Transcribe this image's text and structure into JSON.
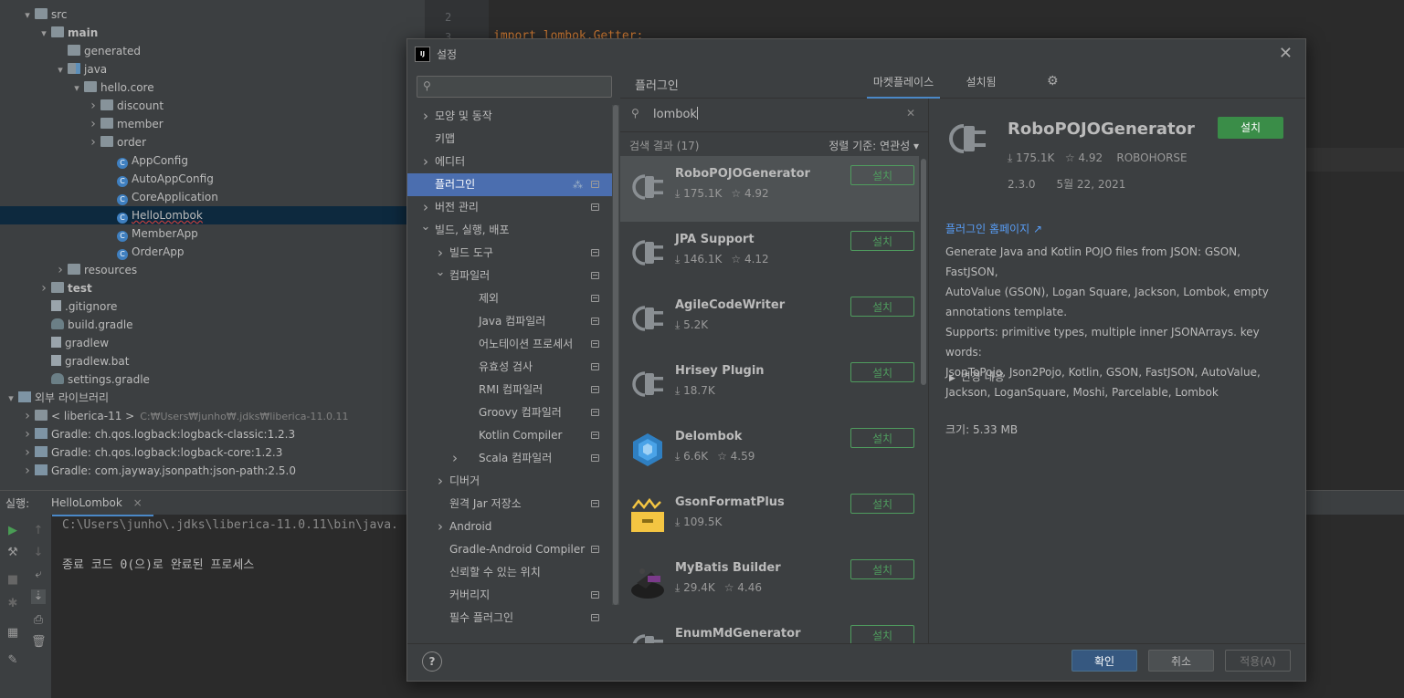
{
  "project_tree": [
    {
      "label": "src",
      "indent": 1,
      "arrow": "v",
      "icon": "folder",
      "bold": false
    },
    {
      "label": "main",
      "indent": 2,
      "arrow": "v",
      "icon": "folder",
      "bold": true
    },
    {
      "label": "generated",
      "indent": 3,
      "arrow": "",
      "icon": "folder",
      "bold": false
    },
    {
      "label": "java",
      "indent": 3,
      "arrow": "v",
      "icon": "folder-src",
      "bold": false
    },
    {
      "label": "hello.core",
      "indent": 4,
      "arrow": "v",
      "icon": "folder",
      "bold": false
    },
    {
      "label": "discount",
      "indent": 5,
      "arrow": ">",
      "icon": "folder",
      "bold": false
    },
    {
      "label": "member",
      "indent": 5,
      "arrow": ">",
      "icon": "folder",
      "bold": false
    },
    {
      "label": "order",
      "indent": 5,
      "arrow": ">",
      "icon": "folder",
      "bold": false
    },
    {
      "label": "AppConfig",
      "indent": 6,
      "arrow": "",
      "icon": "class",
      "bold": false
    },
    {
      "label": "AutoAppConfig",
      "indent": 6,
      "arrow": "",
      "icon": "class",
      "bold": false
    },
    {
      "label": "CoreApplication",
      "indent": 6,
      "arrow": "",
      "icon": "class",
      "bold": false
    },
    {
      "label": "HelloLombok",
      "indent": 6,
      "arrow": "",
      "icon": "class",
      "bold": false,
      "selected": true
    },
    {
      "label": "MemberApp",
      "indent": 6,
      "arrow": "",
      "icon": "class",
      "bold": false
    },
    {
      "label": "OrderApp",
      "indent": 6,
      "arrow": "",
      "icon": "class",
      "bold": false
    },
    {
      "label": "resources",
      "indent": 3,
      "arrow": ">",
      "icon": "folder",
      "bold": false
    },
    {
      "label": "test",
      "indent": 2,
      "arrow": ">",
      "icon": "folder",
      "bold": true
    },
    {
      "label": ".gitignore",
      "indent": 2,
      "arrow": "",
      "icon": "file",
      "bold": false
    },
    {
      "label": "build.gradle",
      "indent": 2,
      "arrow": "",
      "icon": "gradle",
      "bold": false
    },
    {
      "label": "gradlew",
      "indent": 2,
      "arrow": "",
      "icon": "file",
      "bold": false
    },
    {
      "label": "gradlew.bat",
      "indent": 2,
      "arrow": "",
      "icon": "file",
      "bold": false
    },
    {
      "label": "settings.gradle",
      "indent": 2,
      "arrow": "",
      "icon": "gradle",
      "bold": false
    },
    {
      "label": "외부 라이브러리",
      "indent": 0,
      "arrow": "v",
      "icon": "lib",
      "bold": false
    },
    {
      "label": "< liberica-11 >",
      "indent": 1,
      "arrow": ">",
      "icon": "folder",
      "bold": false,
      "dim": "C:₩Users₩junho₩.jdks₩liberica-11.0.11"
    },
    {
      "label": "Gradle: ch.qos.logback:logback-classic:1.2.3",
      "indent": 1,
      "arrow": ">",
      "icon": "lib",
      "bold": false
    },
    {
      "label": "Gradle: ch.qos.logback:logback-core:1.2.3",
      "indent": 1,
      "arrow": ">",
      "icon": "lib",
      "bold": false
    },
    {
      "label": "Gradle: com.jayway.jsonpath:json-path:2.5.0",
      "indent": 1,
      "arrow": ">",
      "icon": "lib",
      "bold": false
    }
  ],
  "editor": {
    "line_numbers": [
      "2",
      "3"
    ],
    "code_line": "import lombok.Getter;"
  },
  "run_panel": {
    "label": "실행:",
    "tab": "HelloLombok",
    "output_path": "C:\\Users\\junho\\.jdks\\liberica-11.0.11\\bin\\java.",
    "output_exit": "종료 코드 0(으)로 완료된 프로세스"
  },
  "dialog": {
    "app_icon": "IJ",
    "title": "설정",
    "close": "✕",
    "search_placeholder": ""
  },
  "settings_tree": [
    {
      "label": "모양 및 동작",
      "level": 0,
      "arrow": ">",
      "page": false
    },
    {
      "label": "키맵",
      "level": 0,
      "arrow": "",
      "page": false
    },
    {
      "label": "에디터",
      "level": 0,
      "arrow": ">",
      "page": false
    },
    {
      "label": "플러그인",
      "level": 0,
      "arrow": "",
      "page": true,
      "selected": true,
      "glob": true
    },
    {
      "label": "버전 관리",
      "level": 0,
      "arrow": ">",
      "page": true
    },
    {
      "label": "빌드, 실행, 배포",
      "level": 0,
      "arrow": "v",
      "page": false
    },
    {
      "label": "빌드 도구",
      "level": 1,
      "arrow": ">",
      "page": true
    },
    {
      "label": "컴파일러",
      "level": 1,
      "arrow": "v",
      "page": true
    },
    {
      "label": "제외",
      "level": 2,
      "arrow": "",
      "page": true
    },
    {
      "label": "Java 컴파일러",
      "level": 2,
      "arrow": "",
      "page": true
    },
    {
      "label": "어노테이션 프로세서",
      "level": 2,
      "arrow": "",
      "page": true
    },
    {
      "label": "유효성 검사",
      "level": 2,
      "arrow": "",
      "page": true
    },
    {
      "label": "RMI 컴파일러",
      "level": 2,
      "arrow": "",
      "page": true
    },
    {
      "label": "Groovy 컴파일러",
      "level": 2,
      "arrow": "",
      "page": true
    },
    {
      "label": "Kotlin Compiler",
      "level": 2,
      "arrow": "",
      "page": true
    },
    {
      "label": "Scala 컴파일러",
      "level": 2,
      "arrow": ">",
      "page": true
    },
    {
      "label": "디버거",
      "level": 1,
      "arrow": ">",
      "page": false
    },
    {
      "label": "원격 Jar 저장소",
      "level": 1,
      "arrow": "",
      "page": true
    },
    {
      "label": "Android",
      "level": 1,
      "arrow": ">",
      "page": false
    },
    {
      "label": "Gradle-Android Compiler",
      "level": 1,
      "arrow": "",
      "page": true
    },
    {
      "label": "신뢰할 수 있는 위치",
      "level": 1,
      "arrow": "",
      "page": false
    },
    {
      "label": "커버리지",
      "level": 1,
      "arrow": "",
      "page": true
    },
    {
      "label": "필수 플러그인",
      "level": 1,
      "arrow": "",
      "page": true
    }
  ],
  "plugins": {
    "title": "플러그인",
    "tab_marketplace": "마켓플레이스",
    "tab_installed": "설치됨",
    "search_value": "lombok",
    "clear": "✕",
    "results_count": "검색 결과 (17)",
    "sort_by": "정렬 기준: 연관성 ▾",
    "install_label": "설치",
    "list": [
      {
        "name": "RoboPOJOGenerator",
        "downloads": "175.1K",
        "rating": "4.92",
        "logo": "plug",
        "selected": true
      },
      {
        "name": "JPA Support",
        "downloads": "146.1K",
        "rating": "4.12",
        "logo": "plug"
      },
      {
        "name": "AgileCodeWriter",
        "downloads": "5.2K",
        "rating": "",
        "logo": "plug"
      },
      {
        "name": "Hrisey Plugin",
        "downloads": "18.7K",
        "rating": "",
        "logo": "plug"
      },
      {
        "name": "Delombok",
        "downloads": "6.6K",
        "rating": "4.59",
        "logo": "cube"
      },
      {
        "name": "GsonFormatPlus",
        "downloads": "109.5K",
        "rating": "",
        "logo": "gson"
      },
      {
        "name": "MyBatis Builder",
        "downloads": "29.4K",
        "rating": "4.46",
        "logo": "bird"
      },
      {
        "name": "EnumMdGenerator",
        "downloads": "",
        "rating": "",
        "logo": "plug"
      }
    ]
  },
  "detail": {
    "name": "RoboPOJOGenerator",
    "install": "설치",
    "downloads": "175.1K",
    "rating": "4.92",
    "vendor": "ROBOHORSE",
    "version": "2.3.0",
    "date": "5월 22, 2021",
    "homepage": "플러그인 홈페이지 ↗",
    "description_lines": [
      "Generate Java and Kotlin POJO files from JSON: GSON, FastJSON,",
      "AutoValue (GSON), Logan Square, Jackson, Lombok, empty",
      "annotations template.",
      "Supports: primitive types, multiple inner JSONArrays. key words:",
      "JsonToPojo, Json2Pojo, Kotlin, GSON, FastJSON, AutoValue,",
      "Jackson, LoganSquare, Moshi, Parcelable, Lombok"
    ],
    "changes": "변경 내용",
    "size": "크기: 5.33 MB"
  },
  "footer": {
    "help": "?",
    "ok": "확인",
    "cancel": "취소",
    "apply": "적용(A)"
  },
  "colors": {
    "accent": "#4a88c7",
    "selection": "#4b6eaf",
    "install_green": "#4f9c5e",
    "link": "#589df6"
  }
}
